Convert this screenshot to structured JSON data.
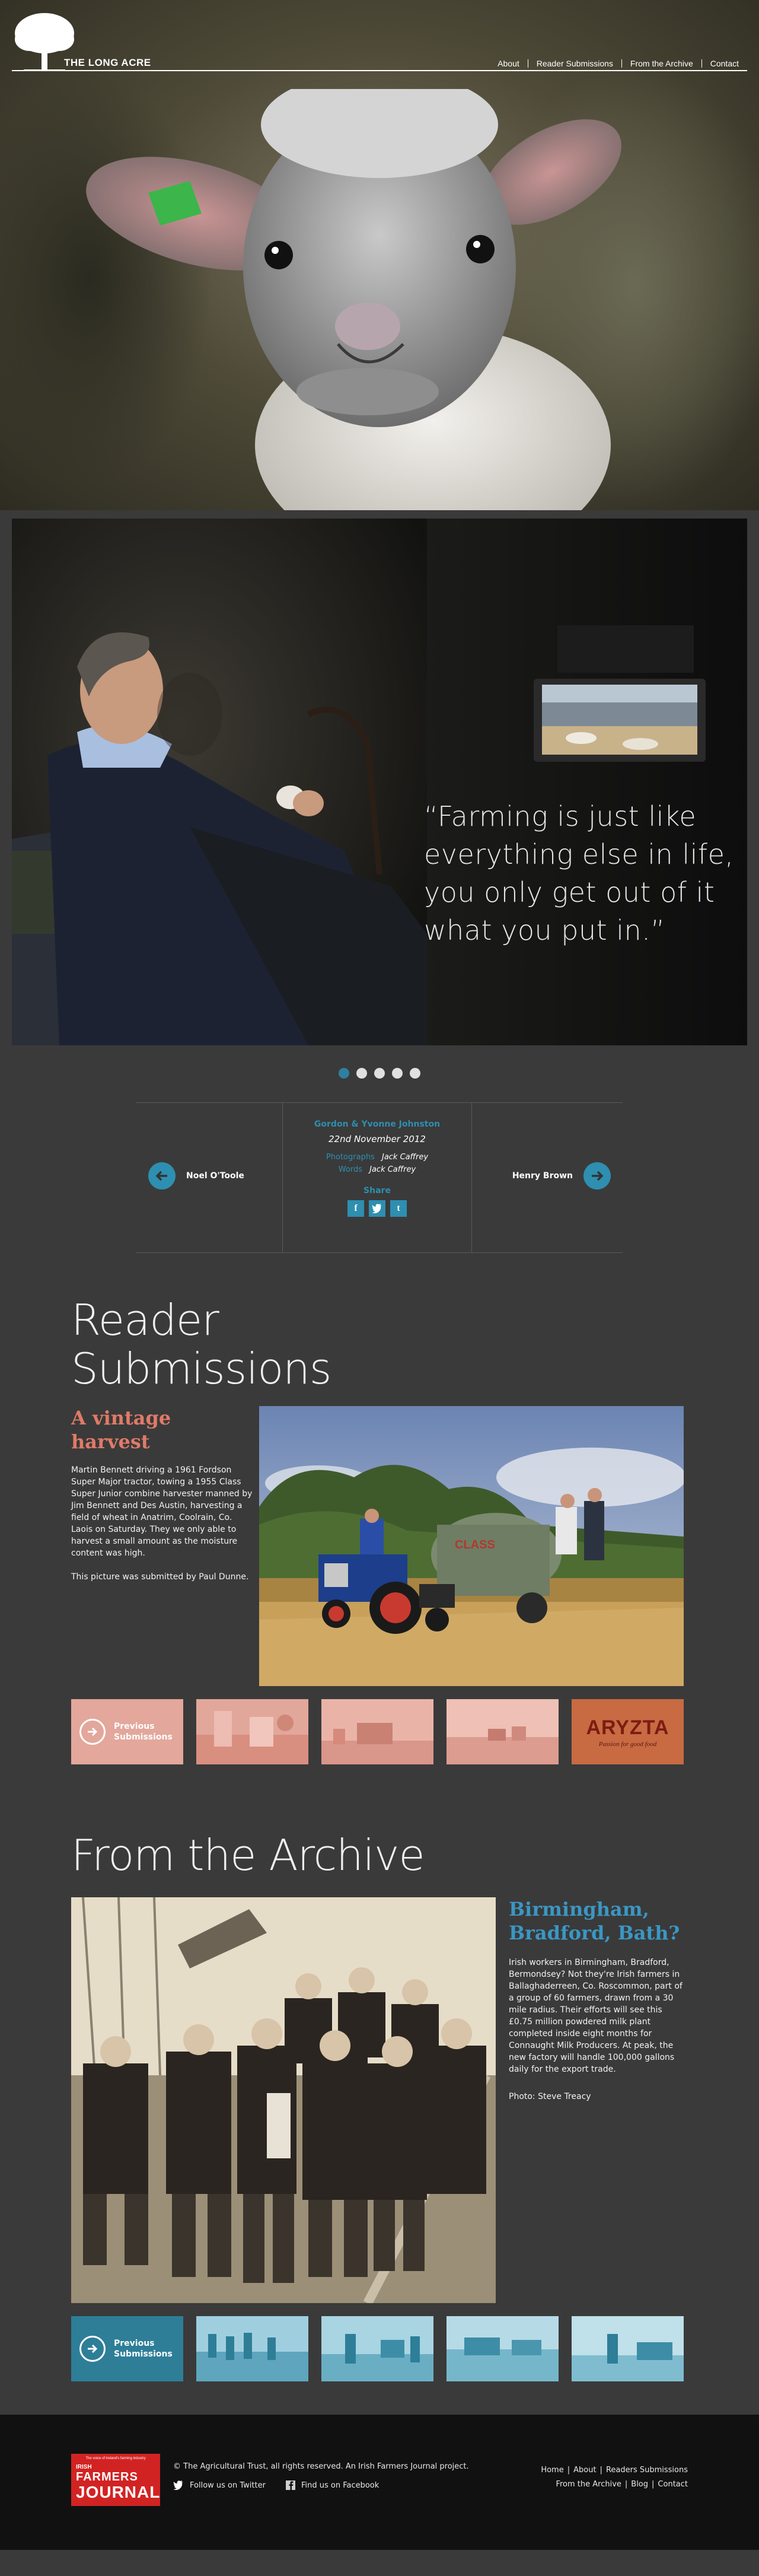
{
  "site": {
    "logo_text": "THE LONG ACRE",
    "nav": [
      "About",
      "Reader Submissions",
      "From the Archive",
      "Contact"
    ]
  },
  "feature": {
    "quote": "“Farming is just like everything else in life, you only get out of it what you put in.”",
    "slides": 5,
    "active_slide": 1
  },
  "credits": {
    "names": "Gordon & Yvonne Johnston",
    "date": "22nd November 2012",
    "photographs_label": "Photographs",
    "photographs_by": "Jack Caffrey",
    "words_label": "Words",
    "words_by": "Jack Caffrey",
    "share_label": "Share",
    "share_icons": [
      "facebook-icon",
      "twitter-icon",
      "tumblr-icon"
    ],
    "prev_name": "Noel O'Toole",
    "next_name": "Henry Brown"
  },
  "reader_submissions": {
    "title": "Reader Submissions",
    "heading": "A vintage harvest",
    "description": "Martin Bennett driving a 1961 Fordson Super Major tractor, towing a 1955 Class Super Junior combine harvester manned by Jim Bennett and Des Austin, harvesting a field of wheat in Anatrim, Coolrain, Co. Laois on Saturday. They we only able to harvest a small amount as the moisture content was high.",
    "credit": "This picture was submitted by Paul Dunne.",
    "previous_label_1": "Previous",
    "previous_label_2": "Submissions",
    "aryzta_brand": "ARYZTA",
    "aryzta_tagline": "Passion for good food"
  },
  "archive": {
    "title": "From the Archive",
    "heading": "Birmingham, Bradford, Bath?",
    "description": "Irish workers in Birmingham, Bradford, Bermondsey? Not they're Irish farmers in Ballaghaderreen, Co. Roscommon, part of a group of 60 farmers, drawn from a 30 mile radius. Their efforts will see this £0.75 million powdered milk plant completed inside eight months for Connaught Milk Producers. At peak, the new factory will handle 100,000 gallons daily for the export trade.",
    "credit": "Photo: Steve Treacy",
    "previous_label_1": "Previous",
    "previous_label_2": "Submissions"
  },
  "footer": {
    "logo_tag": "The voice of Ireland's farming industry",
    "logo_line1": "IRISH",
    "logo_line2": "FARMERS",
    "logo_line3": "JOURNAL",
    "copyright": "©  The Agricultural Trust, all rights reserved. An Irish Farmers Journal project.",
    "twitter": "Follow us on Twitter",
    "facebook": "Find us on Facebook",
    "links_row1": [
      "Home",
      "About",
      "Readers Submissions"
    ],
    "links_row2": [
      "From the Archive",
      "Blog",
      "Contact"
    ]
  },
  "colors": {
    "accent_blue": "#2e8fb0",
    "salmon": "#e07a68",
    "background": "#3a3a3a"
  }
}
